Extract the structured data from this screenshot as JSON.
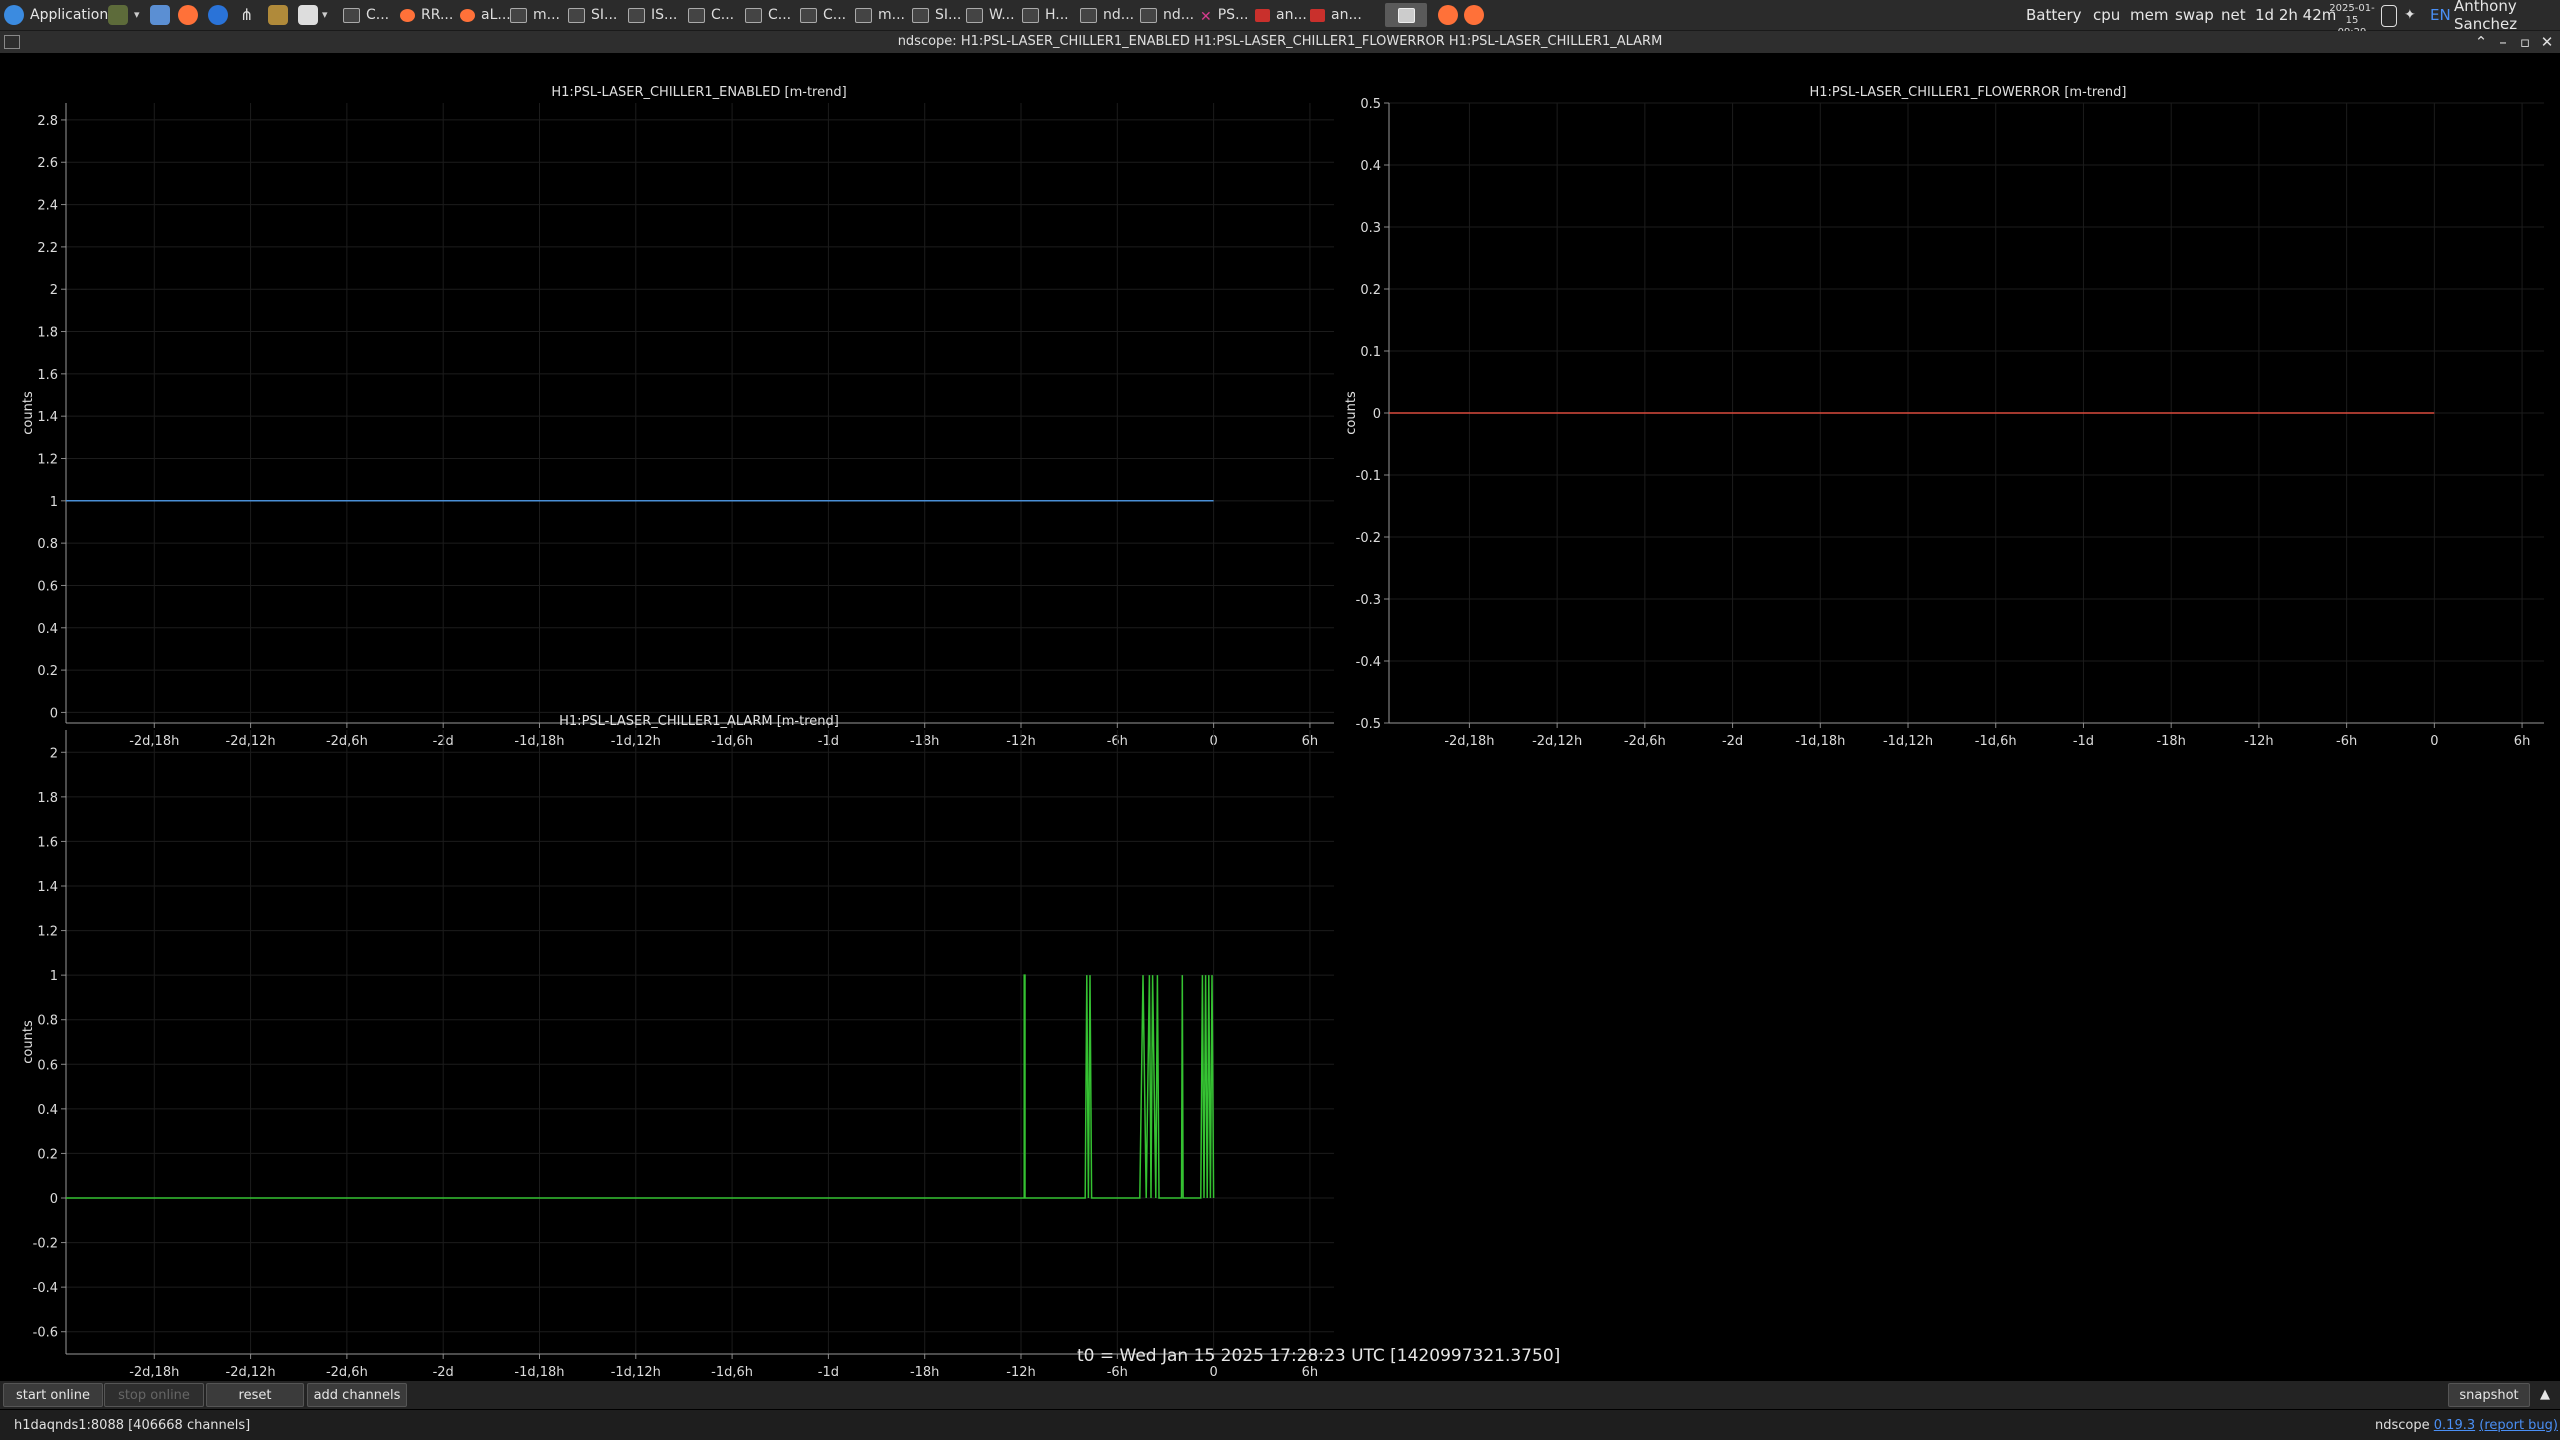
{
  "taskbar": {
    "applications_label": "Applications",
    "tasks": [
      {
        "label": "C...",
        "icon": "window"
      },
      {
        "label": "RR...",
        "icon": "firefox"
      },
      {
        "label": "aL...",
        "icon": "firefox"
      },
      {
        "label": "m...",
        "icon": "window"
      },
      {
        "label": "SI...",
        "icon": "window"
      },
      {
        "label": "IS...",
        "icon": "window"
      },
      {
        "label": "C...",
        "icon": "window"
      },
      {
        "label": "C...",
        "icon": "window"
      },
      {
        "label": "C...",
        "icon": "window"
      },
      {
        "label": "m...",
        "icon": "window"
      },
      {
        "label": "SI...",
        "icon": "window"
      },
      {
        "label": "W...",
        "icon": "window"
      },
      {
        "label": "H...",
        "icon": "window"
      },
      {
        "label": "nd...",
        "icon": "window"
      },
      {
        "label": "nd...",
        "icon": "window"
      },
      {
        "label": "PS...",
        "icon": "x"
      },
      {
        "label": "an...",
        "icon": "red"
      },
      {
        "label": "an...",
        "icon": "red"
      }
    ],
    "tray": {
      "battery": "Battery",
      "cpu": "cpu",
      "mem": "mem",
      "swap": "swap",
      "net": "net",
      "uptime": "1d 2h 42m",
      "date": "2025-01-15",
      "time": "09:29",
      "lang": "EN",
      "user": "Anthony Sanchez"
    }
  },
  "window": {
    "title": "ndscope: H1:PSL-LASER_CHILLER1_ENABLED H1:PSL-LASER_CHILLER1_FLOWERROR H1:PSL-LASER_CHILLER1_ALARM"
  },
  "chart_data": [
    {
      "type": "line",
      "title": "H1:PSL-LASER_CHILLER1_ENABLED [m-trend]",
      "ylabel": "counts",
      "x_tick_labels": [
        "-2d,18h",
        "-2d,12h",
        "-2d,6h",
        "-2d",
        "-1d,18h",
        "-1d,12h",
        "-1d,6h",
        "-1d",
        "-18h",
        "-12h",
        "-6h",
        "0",
        "6h"
      ],
      "x_ticks_hours": [
        -66,
        -60,
        -54,
        -48,
        -42,
        -36,
        -30,
        -24,
        -18,
        -12,
        -6,
        0,
        6
      ],
      "xlim_hours": [
        -71.5,
        7.5
      ],
      "ylim": [
        -0.05,
        2.88
      ],
      "y_ticks": [
        0,
        0.2,
        0.4,
        0.6,
        0.8,
        1,
        1.2,
        1.4,
        1.6,
        1.8,
        2,
        2.2,
        2.4,
        2.6,
        2.8
      ],
      "y_tick_labels": [
        "0",
        "0.2",
        "0.4",
        "0.6",
        "0.8",
        "1",
        "1.2",
        "1.4",
        "1.6",
        "1.8",
        "2",
        "2.2",
        "2.4",
        "2.6",
        "2.8"
      ],
      "series": [
        {
          "color": "#4a8fd6",
          "x": [
            -71.5,
            0
          ],
          "y": [
            1,
            1
          ]
        }
      ],
      "grid": true
    },
    {
      "type": "line",
      "title": "H1:PSL-LASER_CHILLER1_FLOWERROR [m-trend]",
      "ylabel": "counts",
      "x_tick_labels": [
        "-2d,18h",
        "-2d,12h",
        "-2d,6h",
        "-2d",
        "-1d,18h",
        "-1d,12h",
        "-1d,6h",
        "-1d",
        "-18h",
        "-12h",
        "-6h",
        "0",
        "6h"
      ],
      "x_ticks_hours": [
        -66,
        -60,
        -54,
        -48,
        -42,
        -36,
        -30,
        -24,
        -18,
        -12,
        -6,
        0,
        6
      ],
      "xlim_hours": [
        -71.5,
        7.5
      ],
      "ylim": [
        -0.5,
        0.5
      ],
      "y_ticks": [
        0.5,
        0.4,
        0.3,
        0.2,
        0.1,
        0,
        -0.1,
        -0.2,
        -0.3,
        -0.4,
        -0.5
      ],
      "y_tick_labels": [
        "0.5",
        "0.4",
        "0.3",
        "0.2",
        "0.1",
        "0",
        "-0.1",
        "-0.2",
        "-0.3",
        "-0.4",
        "-0.5"
      ],
      "series": [
        {
          "color": "#d94a3d",
          "x": [
            -71.5,
            0
          ],
          "y": [
            0,
            0
          ]
        }
      ],
      "grid": true
    },
    {
      "type": "line",
      "title": "H1:PSL-LASER_CHILLER1_ALARM [m-trend]",
      "ylabel": "counts",
      "x_tick_labels": [
        "-2d,18h",
        "-2d,12h",
        "-2d,6h",
        "-2d",
        "-1d,18h",
        "-1d,12h",
        "-1d,6h",
        "-1d",
        "-18h",
        "-12h",
        "-6h",
        "0",
        "6h"
      ],
      "x_ticks_hours": [
        -66,
        -60,
        -54,
        -48,
        -42,
        -36,
        -30,
        -24,
        -18,
        -12,
        -6,
        0,
        6
      ],
      "xlim_hours": [
        -71.5,
        7.5
      ],
      "ylim": [
        -0.7,
        2.1
      ],
      "y_ticks": [
        -0.6,
        -0.4,
        -0.2,
        0,
        0.2,
        0.4,
        0.6,
        0.8,
        1,
        1.2,
        1.4,
        1.6,
        1.8,
        2
      ],
      "y_tick_labels": [
        "-0.6",
        "-0.4",
        "-0.2",
        "0",
        "0.2",
        "0.4",
        "0.6",
        "0.8",
        "1",
        "1.2",
        "1.4",
        "1.6",
        "1.8",
        "2"
      ],
      "series": [
        {
          "color": "#35c232",
          "x": [
            -71.5,
            -11.8,
            -11.8,
            -11.75,
            -11.75,
            -8,
            -7.9,
            -7.8,
            -7.7,
            -7.6,
            -7.5,
            -4.6,
            -4.4,
            -4.2,
            -4,
            -3.9,
            -3.8,
            -3.6,
            -3.5,
            -3.4,
            -2,
            -1.95,
            -1.9,
            -0.8,
            -0.7,
            -0.6,
            -0.5,
            -0.4,
            -0.3,
            -0.2,
            -0.1,
            0
          ],
          "y": [
            0,
            0,
            1,
            1,
            0,
            0,
            1,
            0,
            1,
            0,
            0,
            0,
            1,
            0,
            1,
            0,
            1,
            0,
            1,
            0,
            0,
            1,
            0,
            0,
            1,
            0,
            1,
            0,
            1,
            0,
            1,
            0
          ]
        }
      ],
      "grid": true
    }
  ],
  "t0_text": "t0 = Wed Jan 15 2025 17:28:23 UTC [1420997321.3750]",
  "buttons": {
    "start_online": "start online",
    "stop_online": "stop online",
    "reset": "reset",
    "add_channels": "add channels",
    "snapshot": "snapshot"
  },
  "status": {
    "server": "h1daqnds1:8088  [406668 channels]",
    "app_name": "ndscope",
    "version": "0.19.3",
    "report_bug": "(report bug)"
  }
}
